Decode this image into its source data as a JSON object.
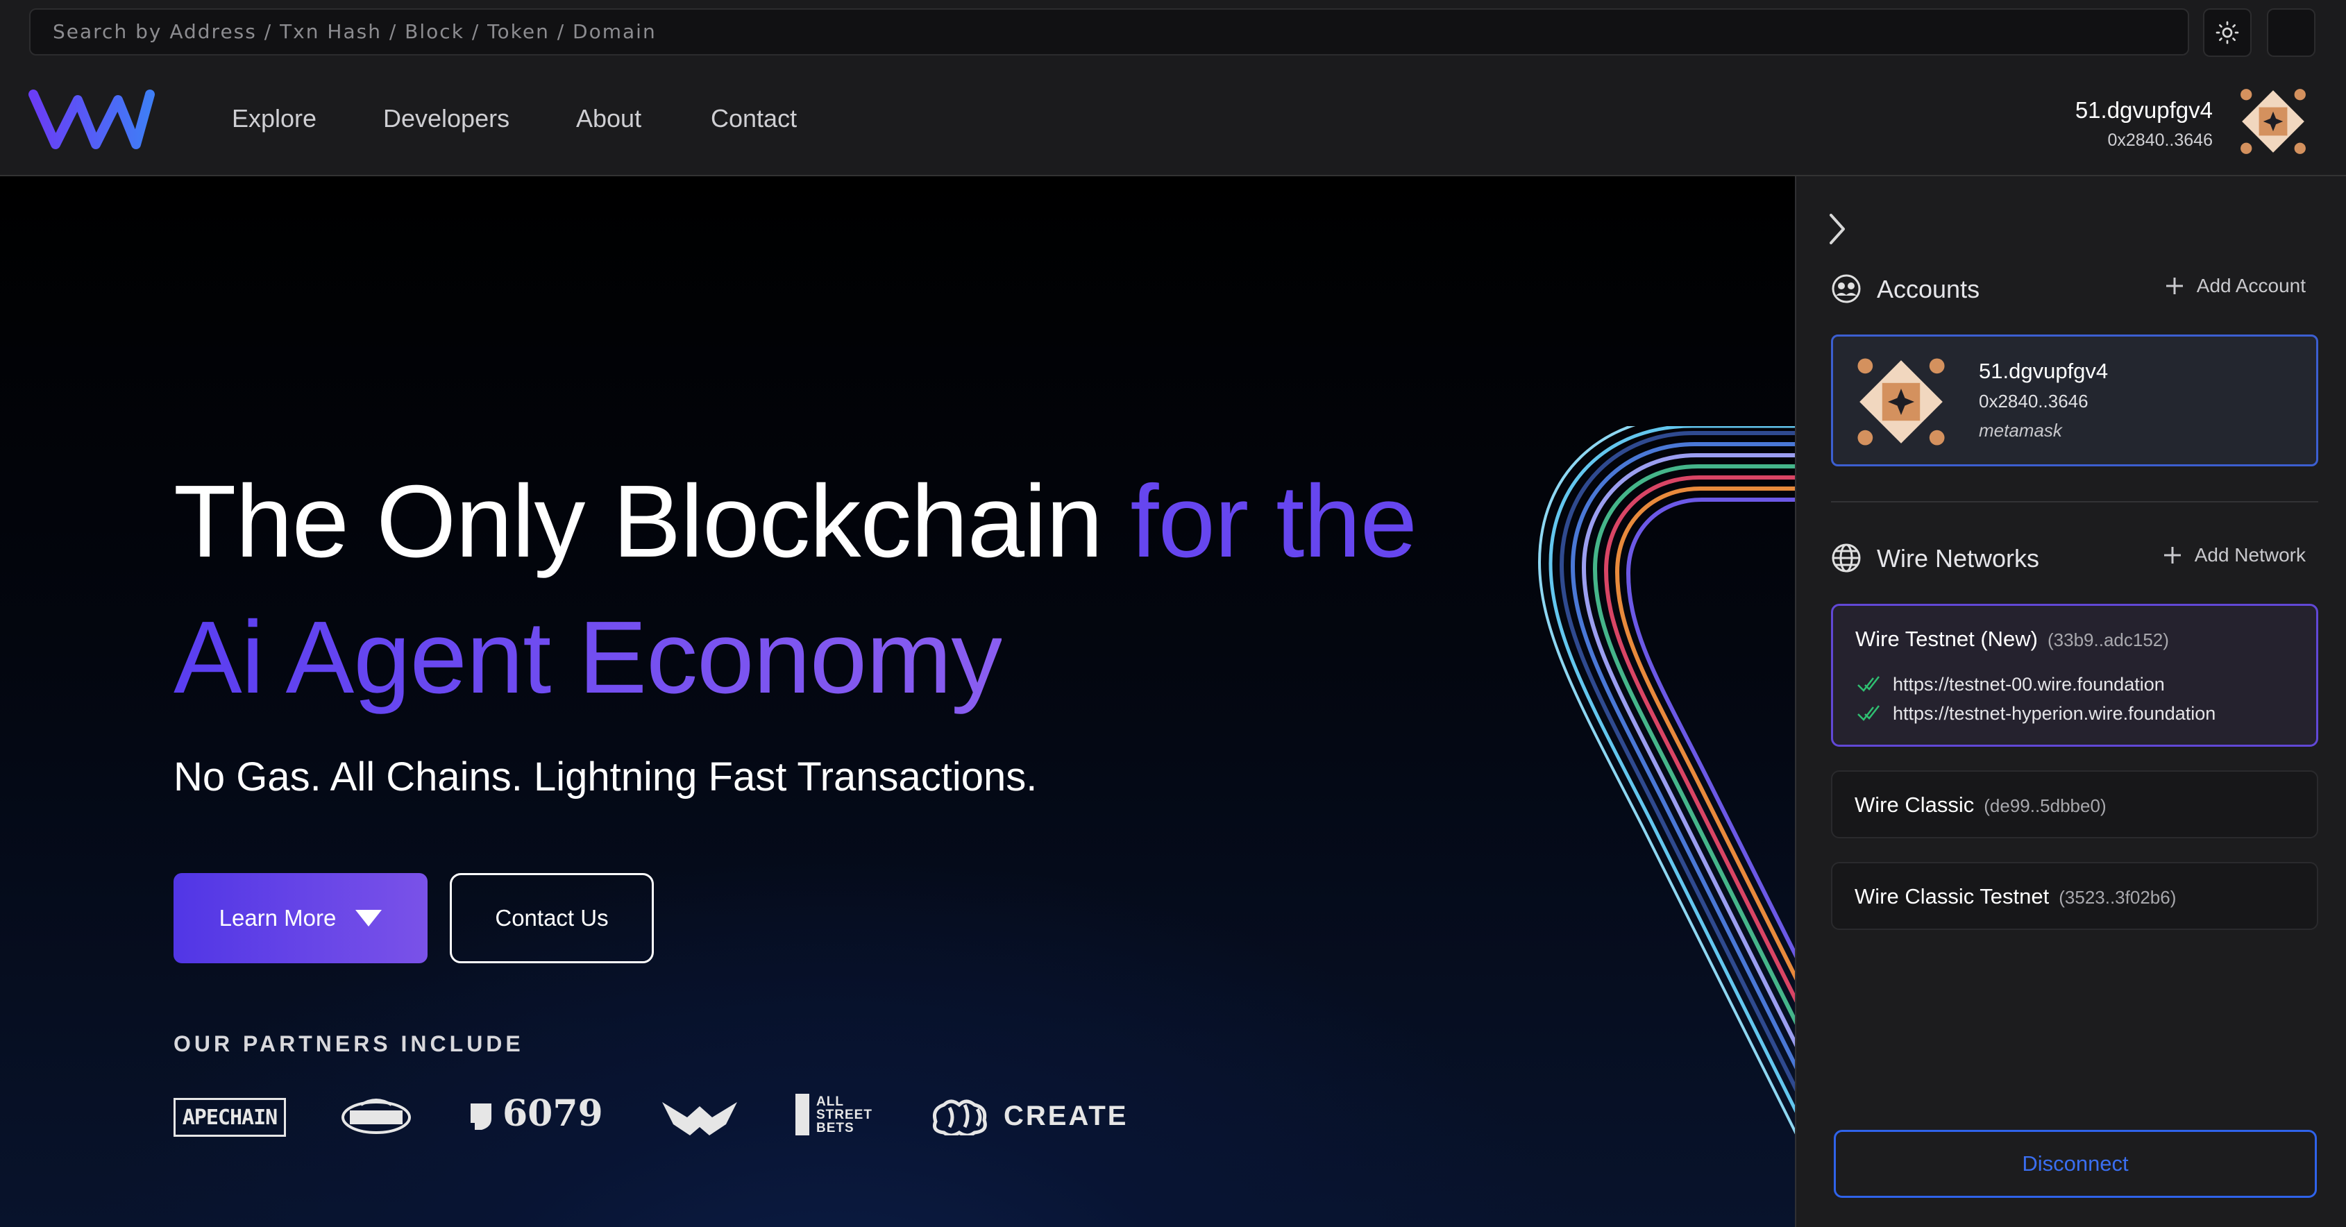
{
  "search": {
    "placeholder": "Search by Address / Txn Hash / Block / Token / Domain"
  },
  "header": {
    "nav": [
      "Explore",
      "Developers",
      "About",
      "Contact"
    ],
    "user": {
      "name": "51.dgvupfgv4",
      "address": "0x2840..3646"
    }
  },
  "hero": {
    "title_white": "The Only Blockchain ",
    "title_purple": "for the",
    "title_line2": "Ai Agent Economy",
    "subtitle": "No Gas. All Chains. Lightning Fast Transactions.",
    "learn_more": "Learn More",
    "contact_us": "Contact Us",
    "partners_title": "OUR PARTNERS INCLUDE",
    "partners": [
      "APECHAIN",
      "6079",
      "ALL",
      "STREET",
      "BETS",
      "CREATE"
    ]
  },
  "panel": {
    "accounts_title": "Accounts",
    "add_account": "Add Account",
    "account": {
      "name": "51.dgvupfgv4",
      "address": "0x2840..3646",
      "wallet": "metamask"
    },
    "networks_title": "Wire Networks",
    "add_network": "Add Network",
    "networks": [
      {
        "name": "Wire Testnet (New)",
        "id": "(33b9..adc152)",
        "urls": [
          "https://testnet-00.wire.foundation",
          "https://testnet-hyperion.wire.foundation"
        ]
      },
      {
        "name": "Wire Classic",
        "id": "(de99..5dbbe0)"
      },
      {
        "name": "Wire Classic Testnet",
        "id": "(3523..3f02b6)"
      }
    ],
    "disconnect": "Disconnect"
  },
  "colors": {
    "accent": "#6646ef",
    "link_blue": "#2f63ea",
    "check_green": "#2fbf71"
  },
  "icons": [
    "sun-icon",
    "wire-logo",
    "chevron-right-icon",
    "accounts-icon",
    "plus-icon",
    "globe-icon",
    "check-icon",
    "caret-down-icon"
  ]
}
